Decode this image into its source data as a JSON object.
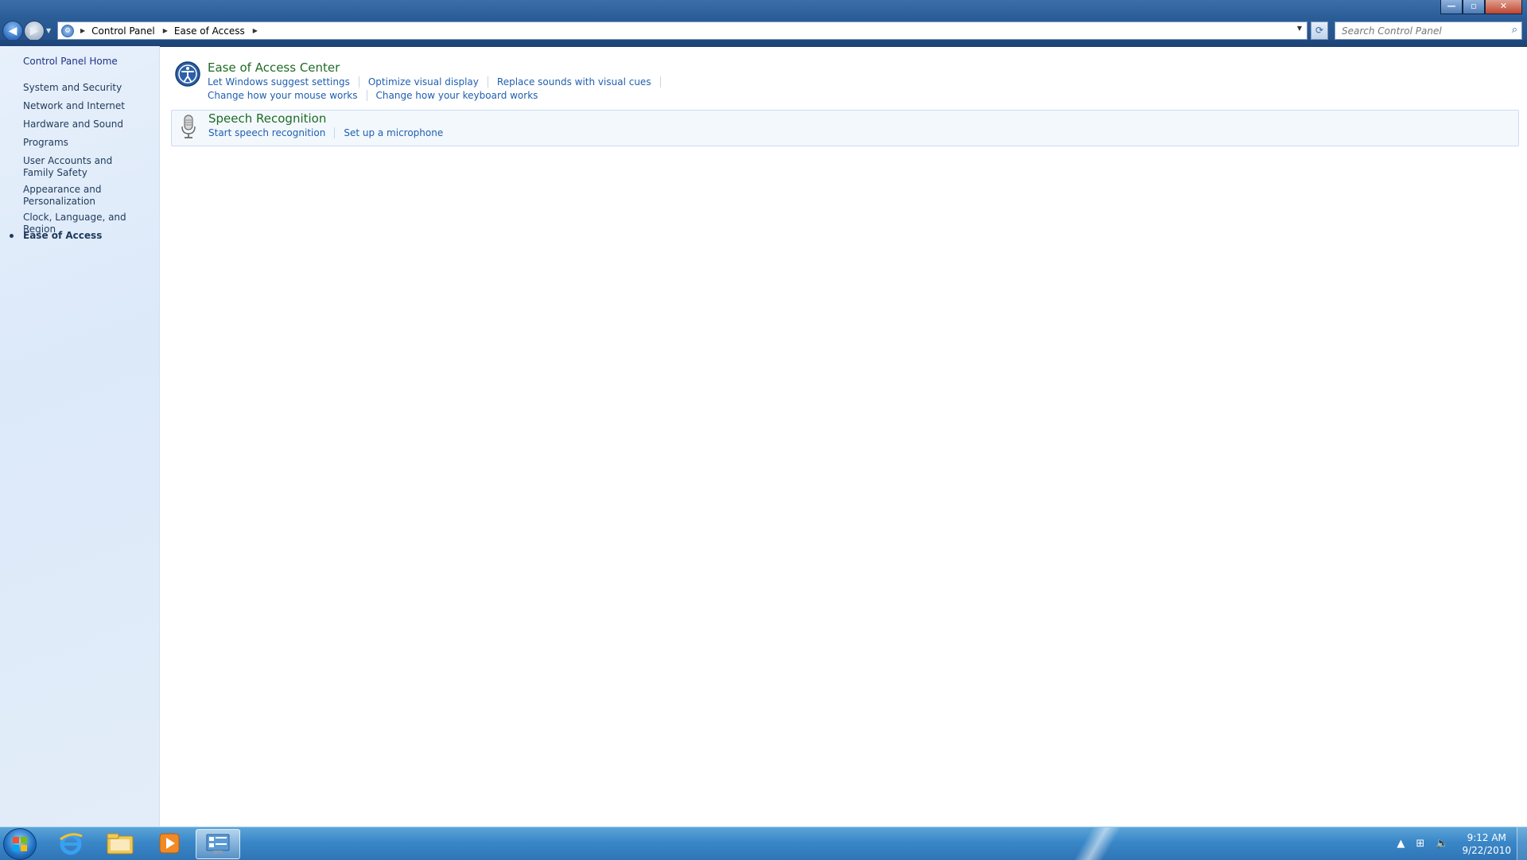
{
  "window": {
    "controls": {
      "minimize": "—",
      "maximize": "▫",
      "close": "✕"
    }
  },
  "address": {
    "crumbs": [
      "Control Panel",
      "Ease of Access"
    ],
    "search_placeholder": "Search Control Panel"
  },
  "sidebar": {
    "home": "Control Panel Home",
    "items": [
      {
        "label": "System and Security"
      },
      {
        "label": "Network and Internet"
      },
      {
        "label": "Hardware and Sound"
      },
      {
        "label": "Programs"
      },
      {
        "label": "User Accounts and Family Safety"
      },
      {
        "label": "Appearance and Personalization"
      },
      {
        "label": "Clock, Language, and Region"
      },
      {
        "label": "Ease of Access",
        "current": true
      }
    ]
  },
  "categories": [
    {
      "title": "Ease of Access Center",
      "icon": "ease-of-access-icon",
      "links": [
        [
          "Let Windows suggest settings",
          "Optimize visual display",
          "Replace sounds with visual cues"
        ],
        [
          "Change how your mouse works",
          "Change how your keyboard works"
        ]
      ]
    },
    {
      "title": "Speech Recognition",
      "icon": "microphone-icon",
      "links": [
        [
          "Start speech recognition",
          "Set up a microphone"
        ]
      ]
    }
  ],
  "taskbar": {
    "pinned": [
      "start-orb",
      "internet-explorer-icon",
      "windows-explorer-icon",
      "media-player-icon",
      "control-panel-icon"
    ],
    "clock": {
      "time": "9:12 AM",
      "date": "9/22/2010"
    }
  },
  "colors": {
    "link": "#1f5fb0",
    "category_title": "#1e6b23",
    "nav_text": "#1e395b",
    "titlebar": "#2a5d97",
    "taskbar": "#3a87c8"
  }
}
